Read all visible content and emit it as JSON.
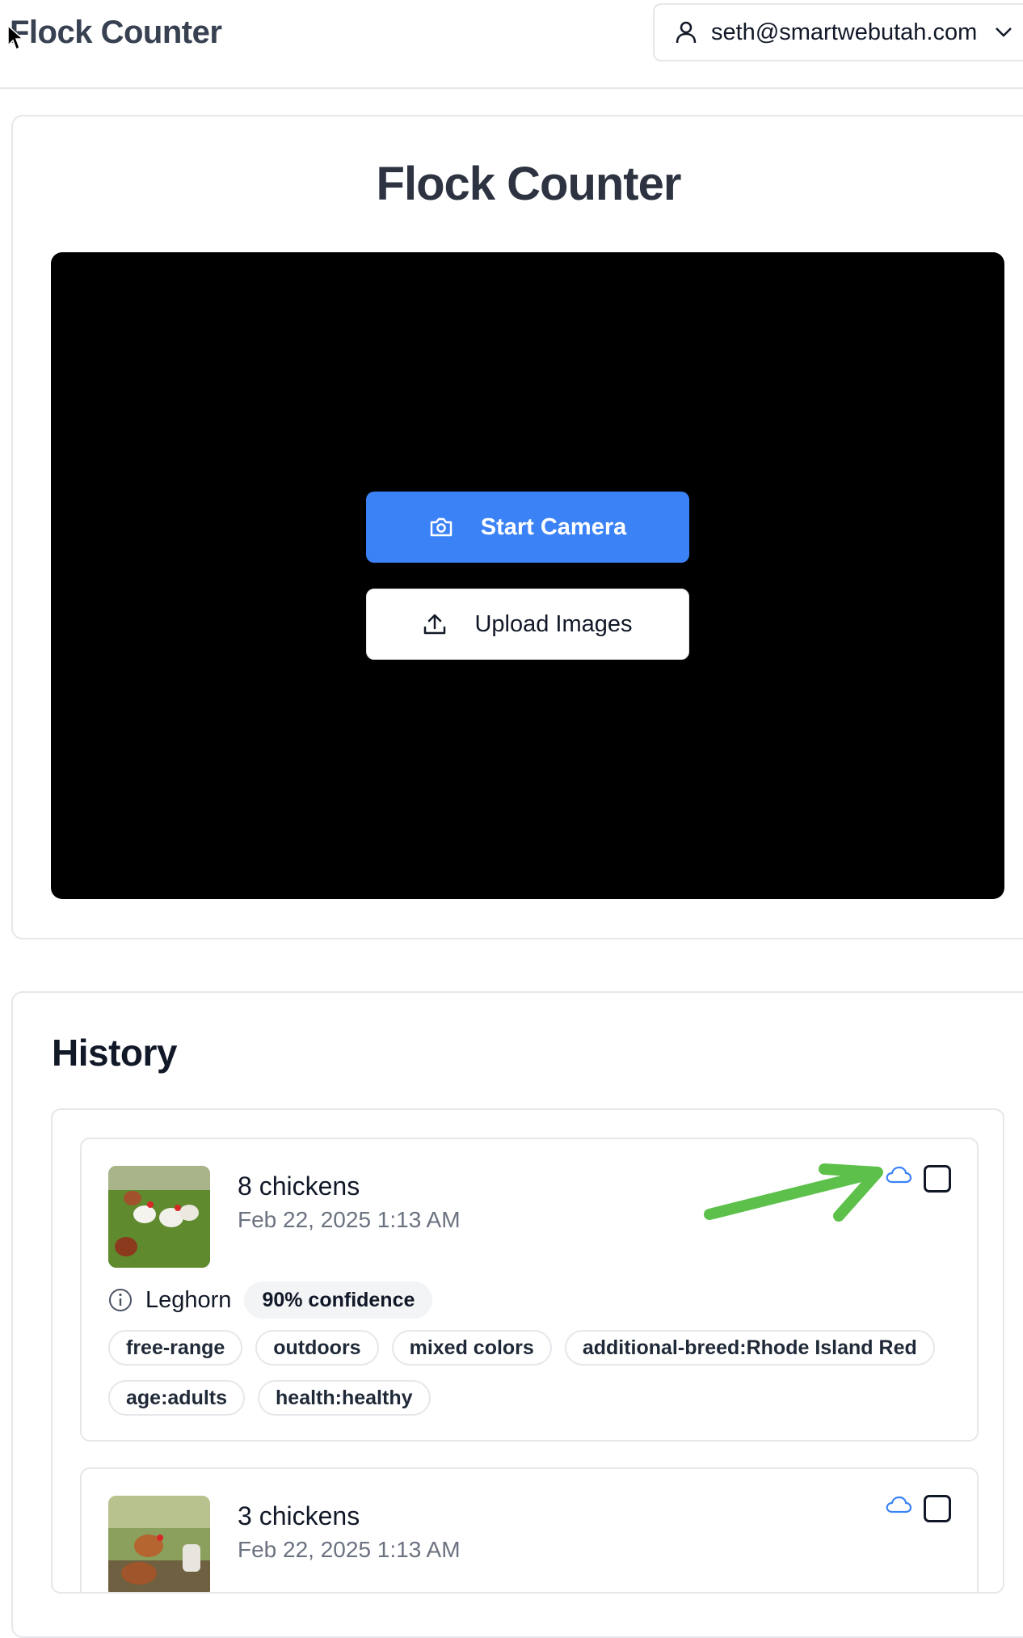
{
  "app": {
    "title": "Flock Counter"
  },
  "user_menu": {
    "email": "seth@smartwebutah.com",
    "icon": "user-icon"
  },
  "main": {
    "heading": "Flock Counter",
    "start_camera_label": "Start Camera",
    "upload_images_label": "Upload Images"
  },
  "history": {
    "heading": "History",
    "entries": [
      {
        "count": "8 chickens",
        "date": "Feb 22, 2025 1:13 AM",
        "breed": "Leghorn",
        "confidence": "90% confidence",
        "tags": [
          "free-range",
          "outdoors",
          "mixed colors",
          "additional-breed:Rhode Island Red",
          "age:adults",
          "health:healthy"
        ]
      },
      {
        "count": "3 chickens",
        "date": "Feb 22, 2025 1:13 AM"
      }
    ]
  },
  "colors": {
    "primary": "#3b82f6",
    "camera_bg": "#000000",
    "annotation_arrow": "#5cc04a",
    "cloud_icon": "#3b82f6"
  }
}
